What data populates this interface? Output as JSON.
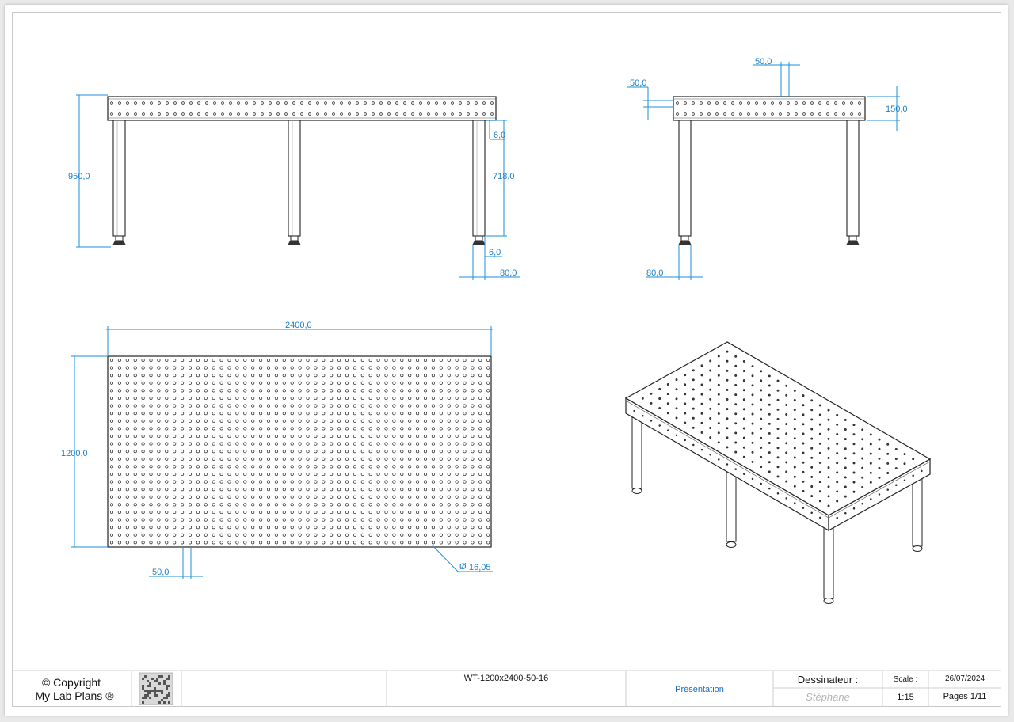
{
  "dimensions": {
    "front_height": "950,0",
    "leg_height": "718,0",
    "foot_gap_top": "6,0",
    "foot_gap_bottom": "6,0",
    "leg_width_front": "80,0",
    "side_hole_top": "50,0",
    "side_hole_left": "50,0",
    "side_thickness": "150,0",
    "leg_width_side": "80,0",
    "top_length": "2400,0",
    "top_width": "1200,0",
    "hole_pitch": "50,0",
    "hole_diameter": "16,05"
  },
  "title_block": {
    "copyright": "© Copyright",
    "company": "My Lab Plans ®",
    "reference": "WT-1200x2400-50-16",
    "sheet_title": "Présentation",
    "designer_label": "Dessinateur :",
    "designer_name": "Stéphane",
    "scale_label": "Scale :",
    "scale_value": "1:15",
    "date": "26/07/2024",
    "pages": "Pages 1/11"
  }
}
